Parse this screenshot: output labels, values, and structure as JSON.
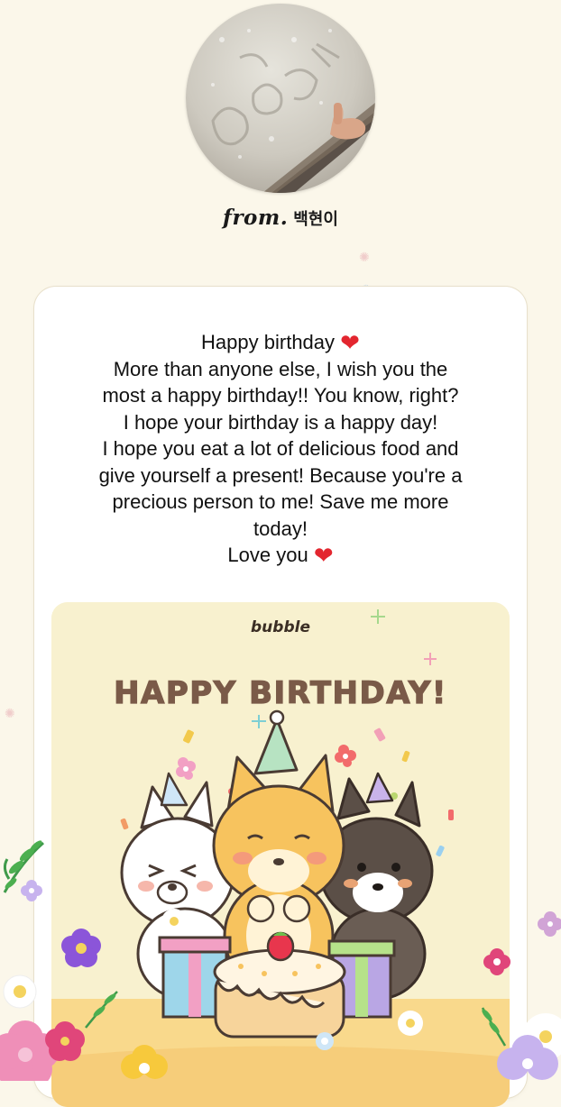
{
  "profile": {
    "from_prefix": "from.",
    "name": "백현이"
  },
  "message": {
    "lines": [
      "Happy birthday",
      "More than anyone else, I wish you the",
      "most a happy birthday!! You know, right?",
      "I hope your birthday is a happy day!",
      "I hope you eat a lot of delicious food and",
      "give yourself a present! Because you're a",
      "precious person to me! Save me more",
      "today!",
      "Love you"
    ],
    "heart": "❤"
  },
  "card": {
    "brand": "bubble",
    "title": "HAPPY BIRTHDAY!"
  },
  "colors": {
    "background": "#fbf7ea",
    "heart": "#e3262f",
    "card_bg": "#f8f1cf",
    "title_brown": "#7a5a48"
  },
  "icons": {
    "avatar": "snow-photo-avatar",
    "heart": "red-heart-icon",
    "flowers": "flower-decoration"
  }
}
